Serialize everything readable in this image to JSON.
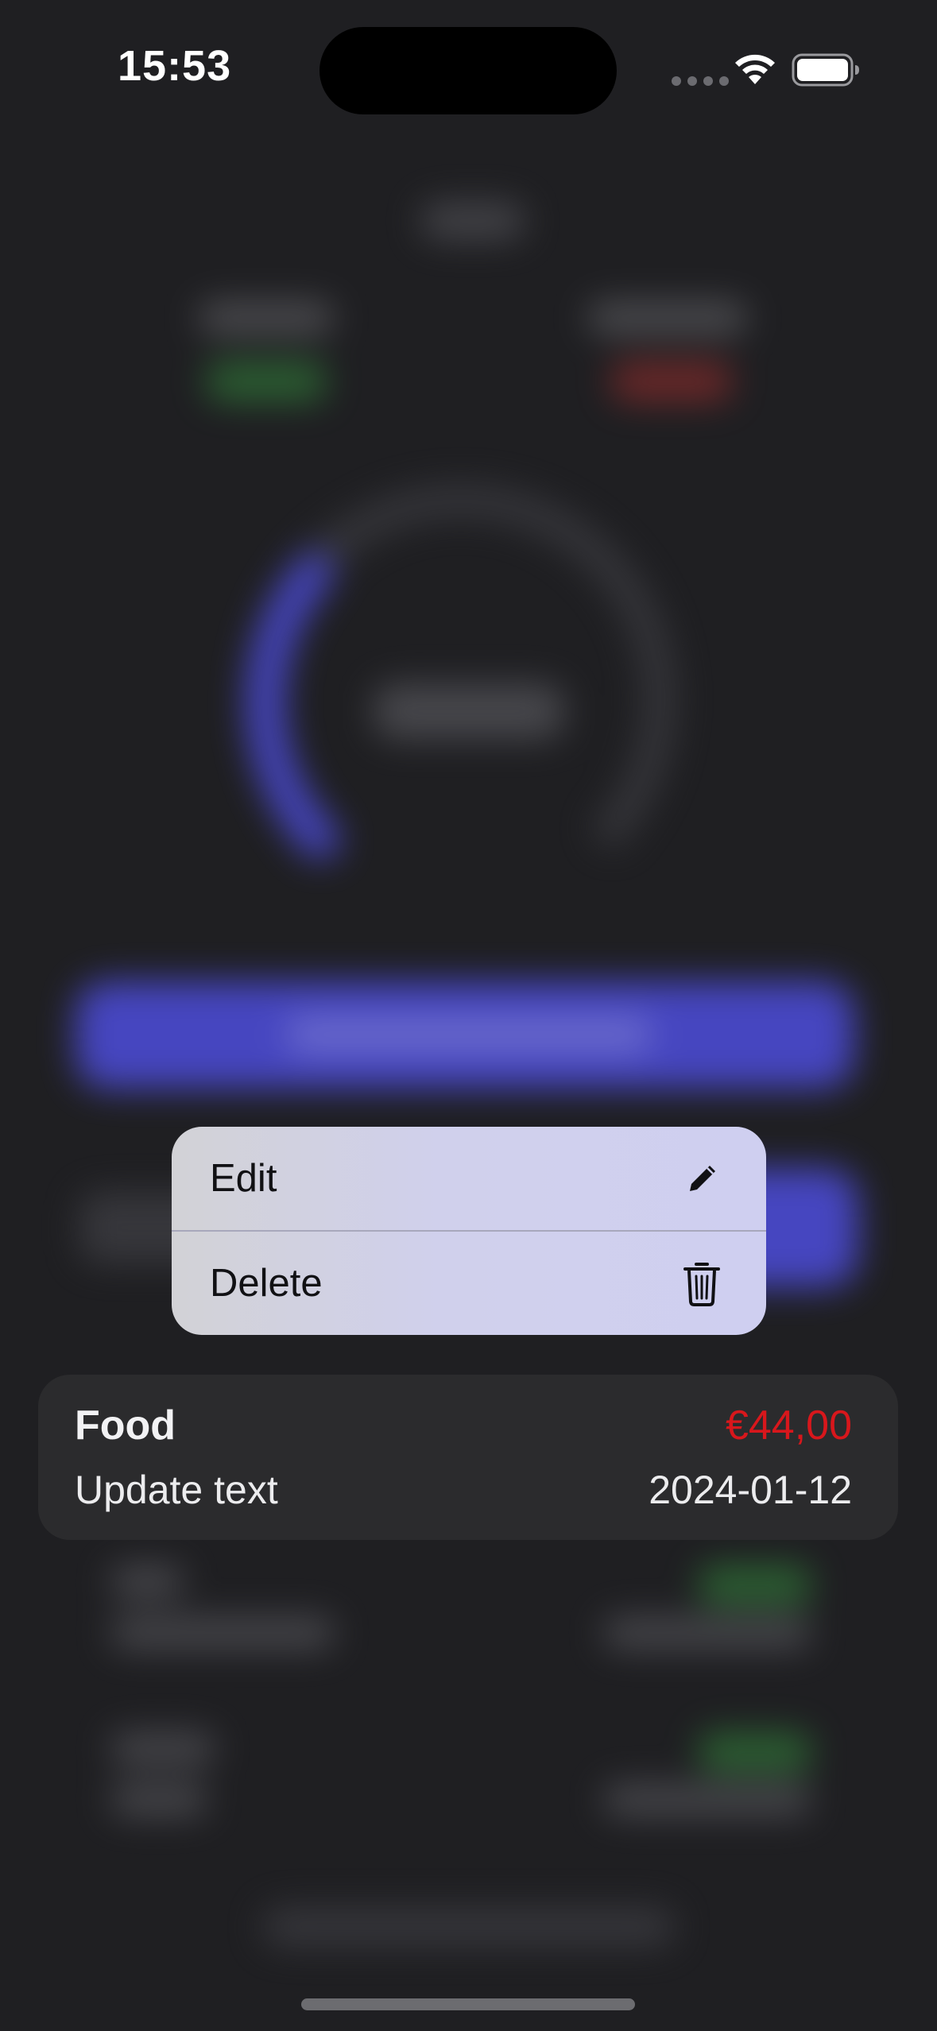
{
  "status_bar": {
    "time": "15:53",
    "wifi_icon": "wifi-icon",
    "battery_icon": "battery-icon"
  },
  "context_menu": {
    "items": [
      {
        "label": "Edit",
        "icon": "pencil-icon"
      },
      {
        "label": "Delete",
        "icon": "trash-icon"
      }
    ]
  },
  "transaction": {
    "category": "Food",
    "amount": "€44,00",
    "note": "Update text",
    "date": "2024-01-12",
    "amount_color": "#d8171c"
  },
  "colors": {
    "accent": "#4d4ddc",
    "background": "#1f1f22",
    "card": "#2b2b2d"
  }
}
